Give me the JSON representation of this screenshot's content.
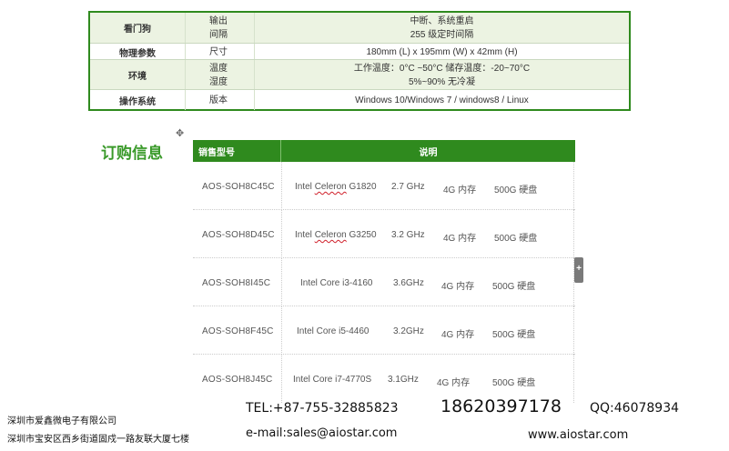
{
  "spec_table": {
    "rows": [
      {
        "category": "看门狗",
        "params": [
          "输出",
          "间隔"
        ],
        "values": [
          "中断、系统重启",
          "255 级定时间隔"
        ]
      },
      {
        "category": "物理参数",
        "params": [
          "尺寸"
        ],
        "values": [
          "180mm (L) x 195mm (W) x 42mm (H)"
        ]
      },
      {
        "category": "环境",
        "params": [
          "温度",
          "湿度"
        ],
        "values": [
          "工作温度：0°C ~50°C     储存温度：-20~70°C",
          "5%~90% 无冷凝"
        ]
      },
      {
        "category": "操作系统",
        "params": [
          "版本"
        ],
        "values": [
          "Windows 10/Windows 7 / windows8 / Linux"
        ]
      }
    ]
  },
  "ordering": {
    "title": "订购信息",
    "header": {
      "model": "销售型号",
      "description": "说明"
    },
    "rows": [
      {
        "model": "AOS-SOH8C45C",
        "cpu": "Intel Celeron G1820",
        "freq": "2.7 GHz",
        "memory": "4G 内存",
        "disk": "500G 硬盘"
      },
      {
        "model": "AOS-SOH8D45C",
        "cpu": "Intel Celeron G3250",
        "freq": "3.2 GHz",
        "memory": "4G 内存",
        "disk": "500G 硬盘"
      },
      {
        "model": "AOS-SOH8I45C",
        "cpu": "Intel Core i3-4160",
        "freq": "3.6GHz",
        "memory": "4G 内存",
        "disk": "500G 硬盘"
      },
      {
        "model": "AOS-SOH8F45C",
        "cpu": "Intel Core i5-4460",
        "freq": "3.2GHz",
        "memory": "4G 内存",
        "disk": "500G 硬盘"
      },
      {
        "model": "AOS-SOH8J45C",
        "cpu": "Intel Core i7-4770S",
        "freq": "3.1GHz",
        "memory": "4G 内存",
        "disk": "500G 硬盘"
      }
    ]
  },
  "footer": {
    "company": "深圳市爱鑫微电子有限公司",
    "address": "深圳市宝安区西乡街道固戍一路友联大厦七楼",
    "tel": "TEL:+87-755-32885823",
    "mobile": "18620397178",
    "qq": "QQ:46078934",
    "email": "e-mail:sales@aiostar.com",
    "website": "www.aiostar.com"
  },
  "side_tab_icon": "plus-icon",
  "accent_color": "#2f8a1e"
}
